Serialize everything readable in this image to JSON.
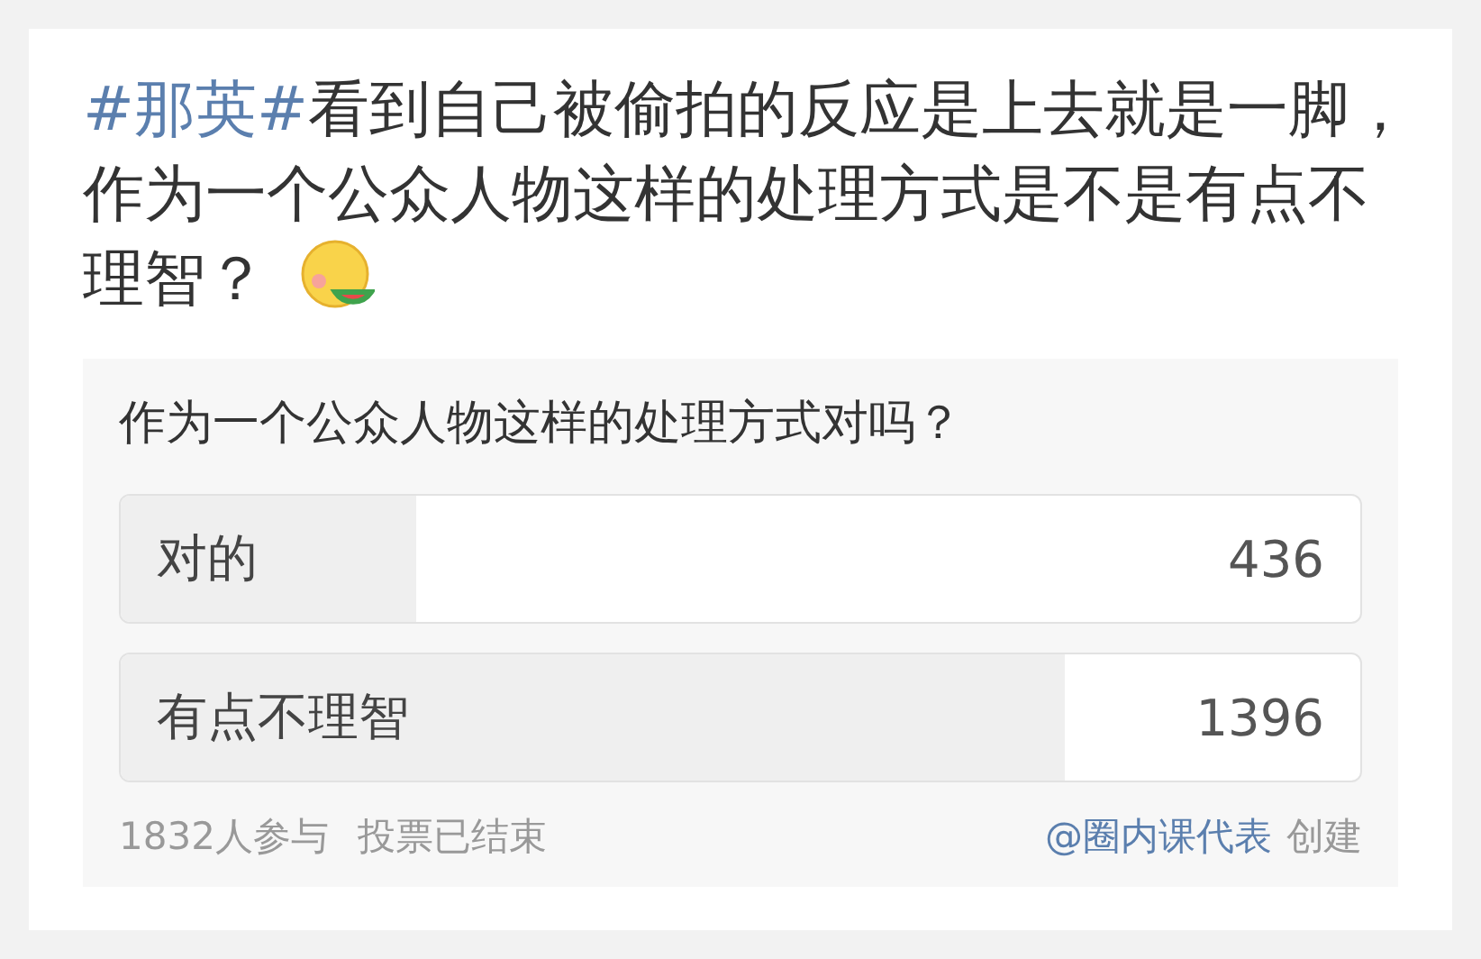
{
  "post": {
    "hashtag": "#那英#",
    "lines": [
      "看到自己被偷拍的反应是上去就是一脚，",
      "作为一个公众人物这样的处理方式是不是有点不理智？"
    ]
  },
  "poll": {
    "question": "作为一个公众人物这样的处理方式对吗？",
    "options": [
      {
        "label": "对的",
        "count": "436",
        "level": 0.238
      },
      {
        "label": "有点不理智",
        "count": "1396",
        "level": 0.762
      }
    ],
    "participants": "1832人参与",
    "status": "投票已结束",
    "creator": "@圈内课代表",
    "created": "创建"
  }
}
